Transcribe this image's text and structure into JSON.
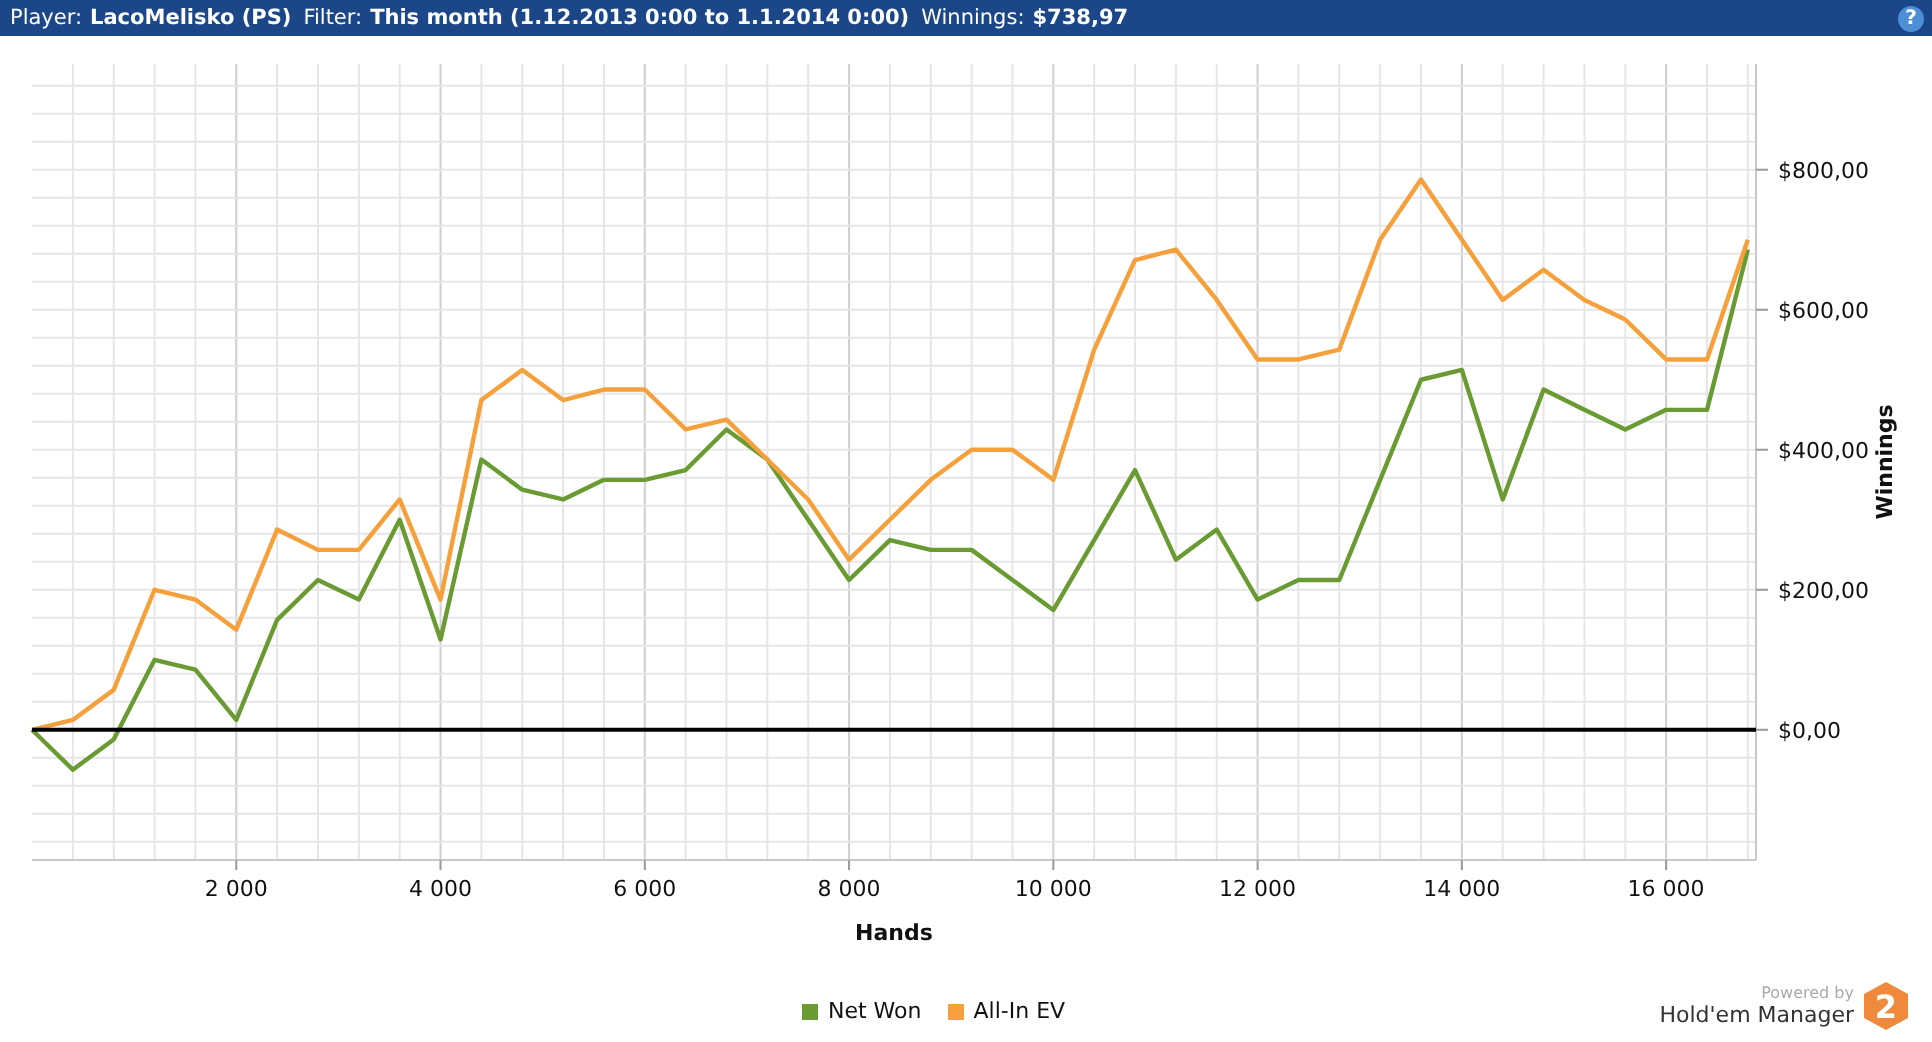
{
  "header": {
    "fields": [
      {
        "label": "Player:",
        "value": "LacoMelisko (PS)"
      },
      {
        "label": "Filter:",
        "value": "This month (1.12.2013 0:00 to 1.1.2014 0:00)"
      },
      {
        "label": "Winnings:",
        "value": "$738,97"
      }
    ],
    "help": "?"
  },
  "chart": {
    "chart_data": {
      "type": "line",
      "xlabel": "Hands",
      "grid": true,
      "ylabel": "Winnings",
      "xlim": [
        0,
        16880
      ],
      "ylim": [
        -186,
        951
      ],
      "x": [
        0,
        400,
        800,
        1200,
        1600,
        2000,
        2400,
        2800,
        3200,
        3600,
        4000,
        4400,
        4800,
        5200,
        5600,
        6000,
        6400,
        6800,
        7200,
        7600,
        8000,
        8400,
        8800,
        9200,
        9600,
        10000,
        10400,
        10800,
        11200,
        11600,
        12000,
        12400,
        12800,
        13200,
        13600,
        14000,
        14400,
        14800,
        15200,
        15600,
        16000,
        16400,
        16800
      ],
      "xticks": [
        {
          "value": 2000,
          "label": "2 000"
        },
        {
          "value": 4000,
          "label": "4 000"
        },
        {
          "value": 6000,
          "label": "6 000"
        },
        {
          "value": 8000,
          "label": "8 000"
        },
        {
          "value": 10000,
          "label": "10 000"
        },
        {
          "value": 12000,
          "label": "12 000"
        },
        {
          "value": 14000,
          "label": "14 000"
        },
        {
          "value": 16000,
          "label": "16 000"
        }
      ],
      "yticks": [
        {
          "value": 0,
          "label": "$0,00"
        },
        {
          "value": 200,
          "label": "$200,00"
        },
        {
          "value": 400,
          "label": "$400,00"
        },
        {
          "value": 600,
          "label": "$600,00"
        },
        {
          "value": 800,
          "label": "$800,00"
        }
      ],
      "series": [
        {
          "name": "Net Won",
          "color": "#6a9a32",
          "values": [
            0,
            -57,
            -14,
            100,
            86,
            14,
            157,
            214,
            186,
            300,
            129,
            386,
            343,
            329,
            357,
            357,
            371,
            429,
            386,
            300,
            214,
            271,
            257,
            257,
            214,
            171,
            271,
            371,
            243,
            286,
            186,
            214,
            214,
            357,
            500,
            514,
            329,
            486,
            457,
            429,
            457,
            457,
            686
          ]
        },
        {
          "name": "All-In EV",
          "color": "#f5a03a",
          "values": [
            0,
            14,
            57,
            200,
            186,
            143,
            286,
            257,
            257,
            329,
            186,
            471,
            514,
            471,
            486,
            486,
            429,
            443,
            386,
            329,
            243,
            300,
            357,
            400,
            400,
            357,
            543,
            671,
            686,
            614,
            529,
            529,
            543,
            700,
            786,
            700,
            614,
            657,
            614,
            586,
            529,
            529,
            700
          ]
        }
      ]
    }
  },
  "branding": {
    "caption": "Powered by",
    "product": "Hold'em Manager",
    "badge": "2"
  }
}
